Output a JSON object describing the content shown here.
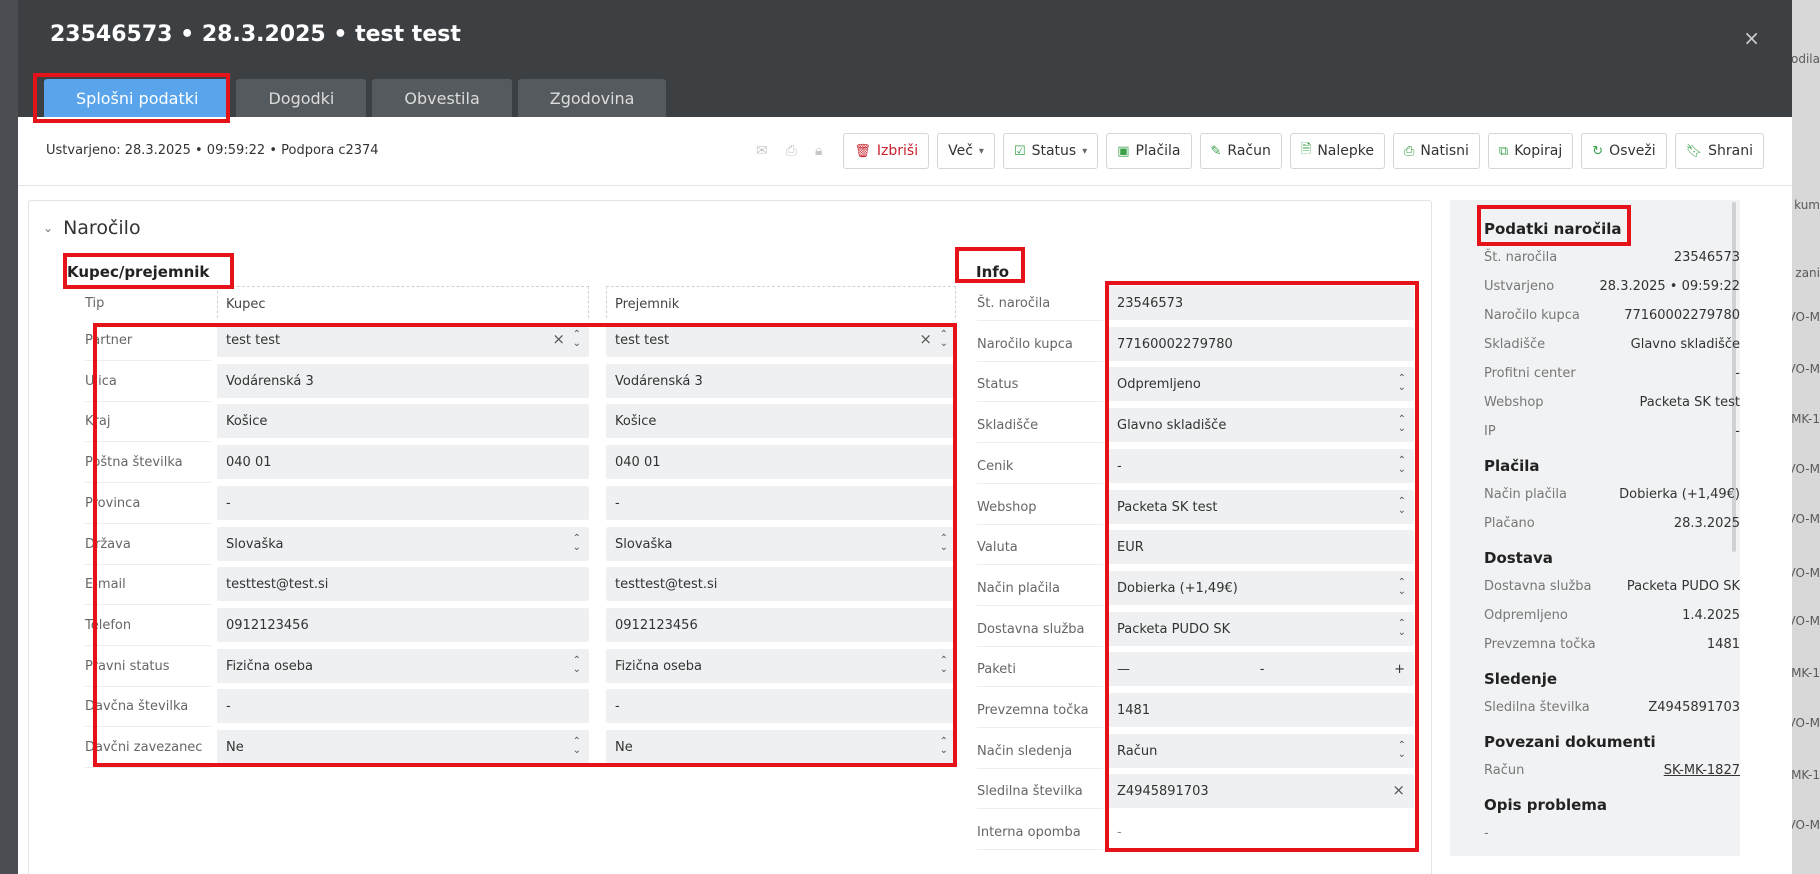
{
  "modal": {
    "title": "23546573 • 28.3.2025 • test test",
    "close": "×"
  },
  "tabs": [
    "Splošni podatki",
    "Dogodki",
    "Obvestila",
    "Zgodovina"
  ],
  "toolbar": {
    "created": "Ustvarjeno: 28.3.2025 • 09:59:22 • Podpora c2374",
    "buttons": {
      "delete": "Izbriši",
      "more": "Več",
      "status": "Status",
      "payments": "Plačila",
      "invoice": "Račun",
      "labels": "Nalepke",
      "print": "Natisni",
      "copy": "Kopiraj",
      "refresh": "Osveži",
      "save": "Shrani"
    }
  },
  "section": {
    "title": "Naročilo",
    "buyer_title": "Kupec/prejemnik",
    "info_title": "Info",
    "col_type": "Tip",
    "col_buyer": "Kupec",
    "col_recipient": "Prejemnik",
    "labels": [
      "Partner",
      "Ulica",
      "Kraj",
      "Poštna številka",
      "Provinca",
      "Država",
      "E-mail",
      "Telefon",
      "Pravni status",
      "Davčna številka",
      "Davčni zavezanec"
    ],
    "buyer": [
      "test test",
      "Vodárenská 3",
      "Košice",
      "040 01",
      "-",
      "Slovaška",
      "testtest@test.si",
      "0912123456",
      "Fizična oseba",
      "-",
      "Ne"
    ],
    "recipient": [
      "test test",
      "Vodárenská 3",
      "Košice",
      "040 01",
      "-",
      "Slovaška",
      "testtest@test.si",
      "0912123456",
      "Fizična oseba",
      "-",
      "Ne"
    ],
    "info_labels": [
      "Št. naročila",
      "Naročilo kupca",
      "Status",
      "Skladišče",
      "Cenik",
      "Webshop",
      "Valuta",
      "Način plačila",
      "Dostavna služba",
      "Paketi",
      "Prevzemna točka",
      "Način sledenja",
      "Sledilna številka",
      "Interna opomba"
    ],
    "info_values": [
      "23546573",
      "77160002279780",
      "Odpremljeno",
      "Glavno skladišče",
      "-",
      "Packeta SK test",
      "EUR",
      "Dobierka (+1,49€)",
      "Packeta PUDO SK",
      "-",
      "1481",
      "Račun",
      "Z4945891703",
      "-"
    ],
    "paketi": {
      "minus": "—",
      "plus": "+"
    }
  },
  "right_panel": {
    "order_title": "Podatki naročila",
    "order_rows": [
      {
        "k": "Št. naročila",
        "v": "23546573"
      },
      {
        "k": "Ustvarjeno",
        "v": "28.3.2025 • 09:59:22"
      },
      {
        "k": "Naročilo kupca",
        "v": "77160002279780"
      },
      {
        "k": "Skladišče",
        "v": "Glavno skladišče"
      },
      {
        "k": "Profitni center",
        "v": "-"
      },
      {
        "k": "Webshop",
        "v": "Packeta SK test"
      },
      {
        "k": "IP",
        "v": "-"
      }
    ],
    "pay_title": "Plačila",
    "pay_rows": [
      {
        "k": "Način plačila",
        "v": "Dobierka (+1,49€)"
      },
      {
        "k": "Plačano",
        "v": "28.3.2025"
      }
    ],
    "ship_title": "Dostava",
    "ship_rows": [
      {
        "k": "Dostavna služba",
        "v": "Packeta PUDO SK"
      },
      {
        "k": "Odpremljeno",
        "v": "1.4.2025"
      },
      {
        "k": "Prevzemna točka",
        "v": "1481"
      }
    ],
    "track_title": "Sledenje",
    "track_rows": [
      {
        "k": "Sledilna številka",
        "v": "Z4945891703"
      }
    ],
    "docs_title": "Povezani dokumenti",
    "docs_rows": [
      {
        "k": "Račun",
        "v": "SK-MK-1827"
      }
    ],
    "problem_title": "Opis problema",
    "problem_value": "-"
  },
  "background": {
    "strip_texts": [
      "rodila",
      "kum",
      "zani",
      "VO-M",
      "VO-M",
      "MK-1",
      "VO-M",
      "VO-M",
      "VO-M",
      "VO-M",
      "MK-1",
      "VO-M",
      "MK-1",
      "VO-M"
    ]
  },
  "colors": {
    "active_tab": "#5aa4ec",
    "highlight": "#e6121a",
    "danger": "#c8202c",
    "accent_icon": "#3aa04a"
  }
}
